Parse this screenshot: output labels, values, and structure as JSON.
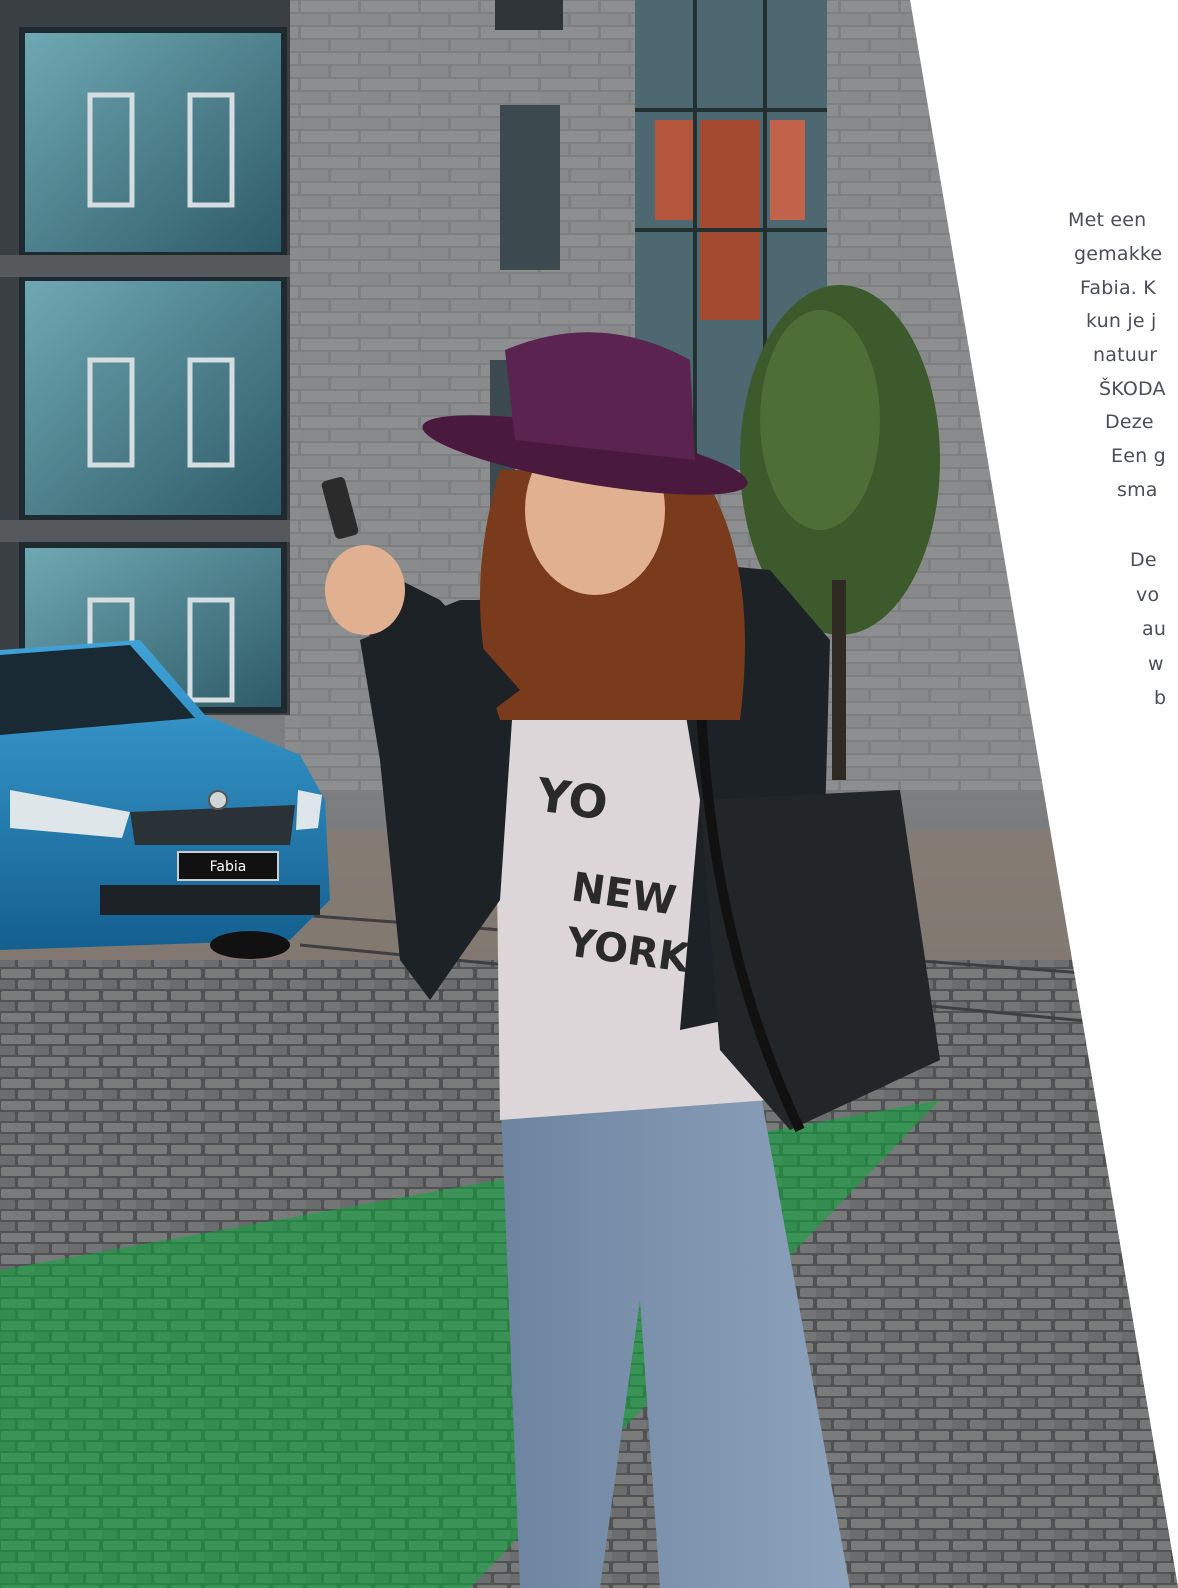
{
  "photo": {
    "description_icon": "photo-scene",
    "license_plate": "Fabia",
    "shirt_print": [
      "YO",
      "NEW",
      "YORK"
    ]
  },
  "colors": {
    "page_bg": "#ffffff",
    "accent_green": "#0aa83a",
    "car_blue": "#1e7fb8",
    "body_text": "#4a4f55"
  },
  "text_column": {
    "lines": [
      "Met een",
      "gemakke",
      "Fabia. K",
      "kun je j",
      "natuur",
      "ŠKODA",
      "Deze",
      "Een g",
      "sma",
      "",
      "De",
      "vo",
      "au",
      "w",
      "b"
    ]
  }
}
